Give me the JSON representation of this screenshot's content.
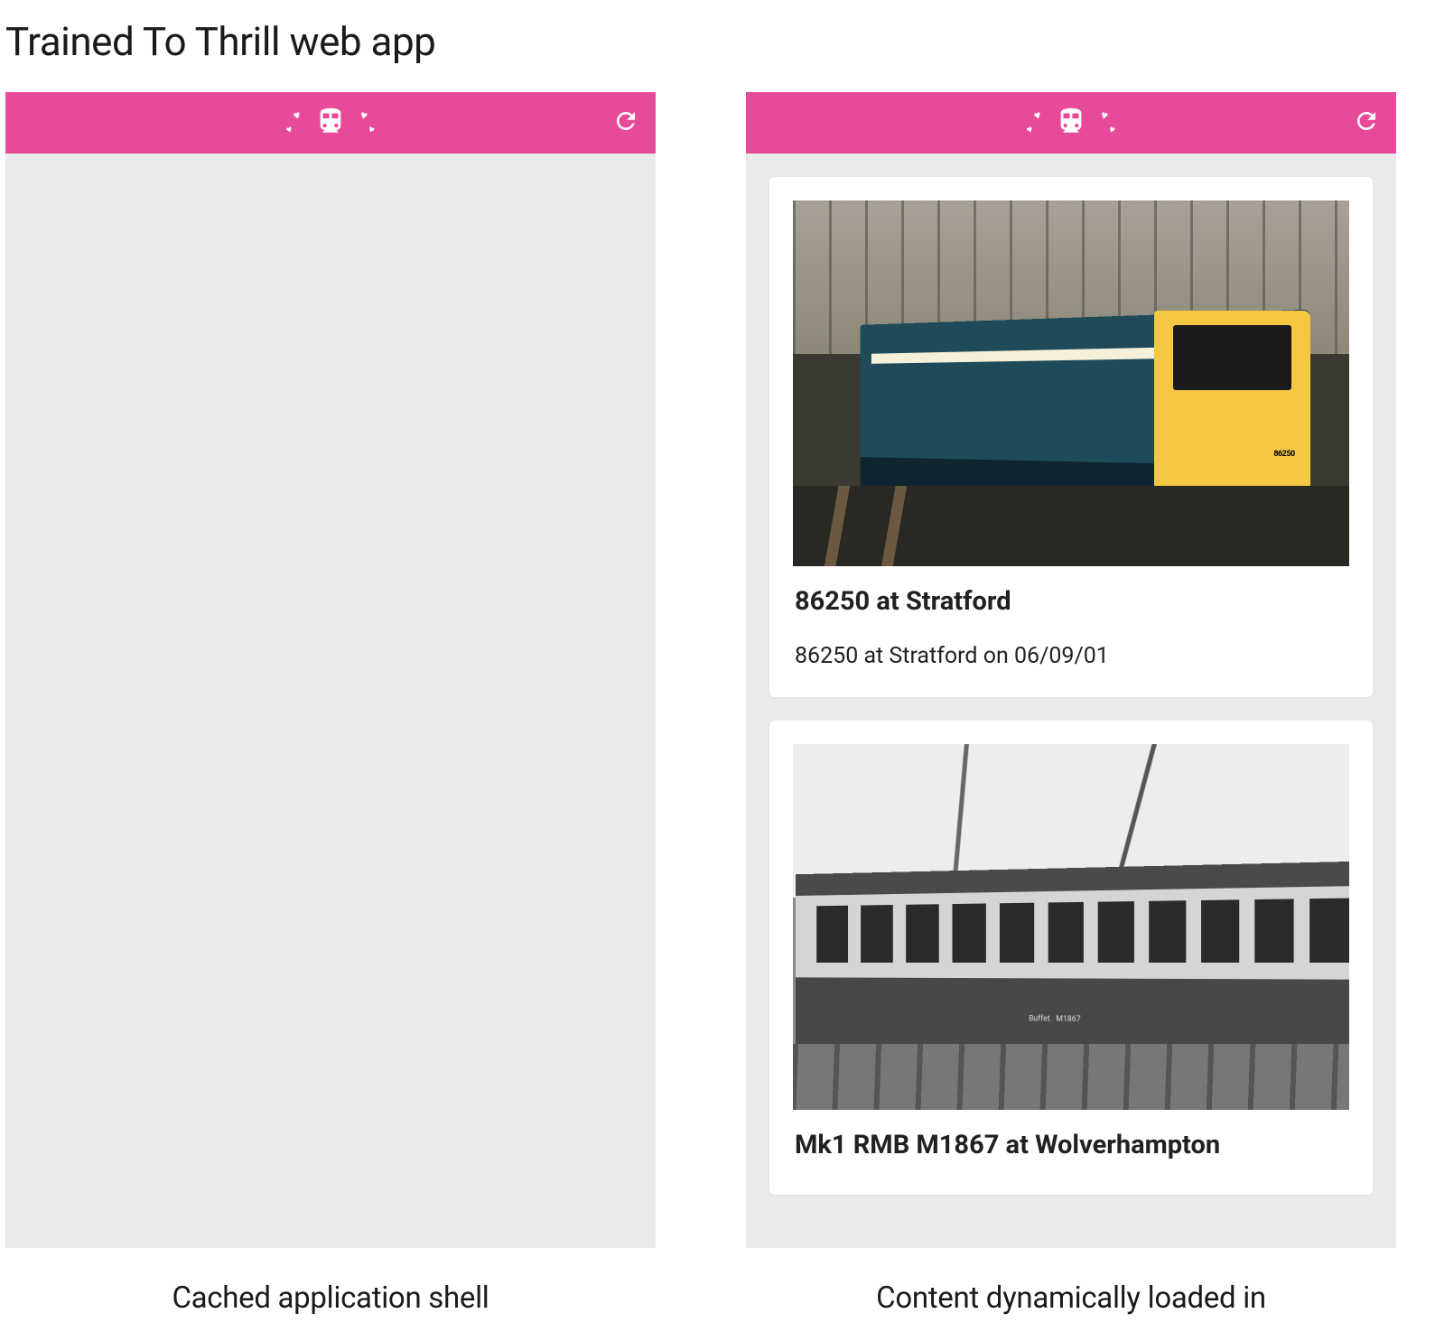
{
  "title": "Trained To Thrill web app",
  "header": {
    "brand_icon": "train-icon",
    "accent_color": "#e84a9a",
    "refresh_icon": "refresh-icon"
  },
  "panels": {
    "left": {
      "caption": "Cached application shell",
      "cards": []
    },
    "right": {
      "caption": "Content dynamically loaded in",
      "cards": [
        {
          "title": "86250 at Stratford",
          "description": "86250 at Stratford on 06/09/01"
        },
        {
          "title": "Mk1 RMB M1867 at Wolverhampton",
          "description": ""
        }
      ]
    }
  }
}
